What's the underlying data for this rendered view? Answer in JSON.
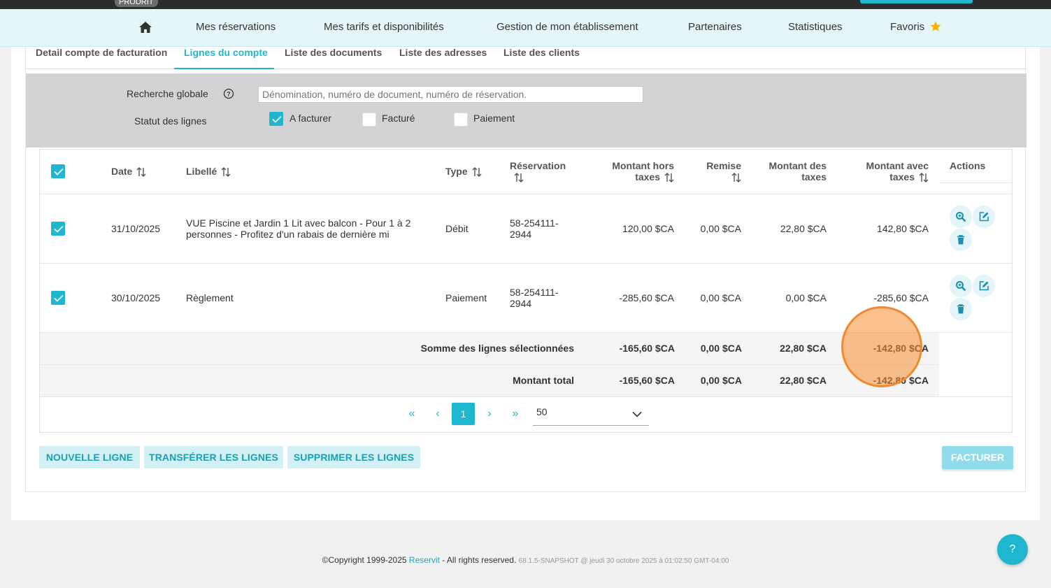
{
  "topbar": {
    "env_badge": "PRODRIT"
  },
  "nav": {
    "items": [
      "Mes réservations",
      "Mes tarifs et disponibilités",
      "Gestion de mon établissement",
      "Partenaires",
      "Statistiques",
      "Favoris"
    ]
  },
  "tabs": [
    "Detail compte de facturation",
    "Lignes du compte",
    "Liste des documents",
    "Liste des adresses",
    "Liste des clients"
  ],
  "filter": {
    "search_label": "Recherche globale",
    "search_placeholder": "Dénomination, numéro de document, numéro de réservation.",
    "status_label": "Statut des lignes",
    "options": [
      {
        "label": "A facturer",
        "checked": true
      },
      {
        "label": "Facturé",
        "checked": false
      },
      {
        "label": "Paiement",
        "checked": false
      }
    ]
  },
  "table": {
    "headers": {
      "date": "Date",
      "libelle": "Libellé",
      "type": "Type",
      "reservation": "Réservation",
      "ht_1": "Montant hors",
      "ht_2": "taxes",
      "remise": "Remise",
      "taxes_1": "Montant des",
      "taxes_2": "taxes",
      "ttc_1": "Montant avec",
      "ttc_2": "taxes",
      "actions": "Actions"
    },
    "rows": [
      {
        "date": "31/10/2025",
        "libelle_1": "VUE Piscine et Jardin 1 Lit avec balcon - Pour 1 à 2",
        "libelle_2": "personnes - Profitez d'un rabais de dernière mi",
        "type": "Débit",
        "reservation_1": "58-254111-",
        "reservation_2": "2944",
        "ht": "120,00 $CA",
        "remise": "0,00 $CA",
        "taxes": "22,80 $CA",
        "ttc": "142,80 $CA"
      },
      {
        "date": "30/10/2025",
        "libelle_1": "Règlement",
        "libelle_2": "",
        "type": "Paiement",
        "reservation_1": "58-254111-",
        "reservation_2": "2944",
        "ht": "-285,60 $CA",
        "remise": "0,00 $CA",
        "taxes": "0,00 $CA",
        "ttc": "-285,60 $CA"
      }
    ],
    "sum_selected": {
      "label": "Somme des lignes sélectionnées",
      "ht": "-165,60 $CA",
      "remise": "0,00 $CA",
      "taxes": "22,80 $CA",
      "ttc": "-142,80 $CA"
    },
    "total": {
      "label": "Montant total",
      "ht": "-165,60 $CA",
      "remise": "0,00 $CA",
      "taxes": "22,80 $CA",
      "ttc": "-142,80 $CA"
    }
  },
  "pager": {
    "first": "«",
    "prev": "‹",
    "page": "1",
    "next": "›",
    "last": "»",
    "page_size": "50"
  },
  "buttons": {
    "new_line": "NOUVELLE LIGNE",
    "transfer": "TRANSFÉRER LES LIGNES",
    "delete": "SUPPRIMER LES LIGNES",
    "invoice": "FACTURER"
  },
  "footer": {
    "copyright": "©Copyright 1999-2025 ",
    "brand": "Reservit",
    "rights": " - All rights reserved. ",
    "version": "68.1.5-SNAPSHOT @ jeudi 30 octobre 2025 à 01:02:50 GMT-04:00"
  },
  "help_fab": "?",
  "colors": {
    "accent": "#1fb6cf",
    "nav_bg": "#e5f6f9",
    "marker": "#f08a2e"
  }
}
